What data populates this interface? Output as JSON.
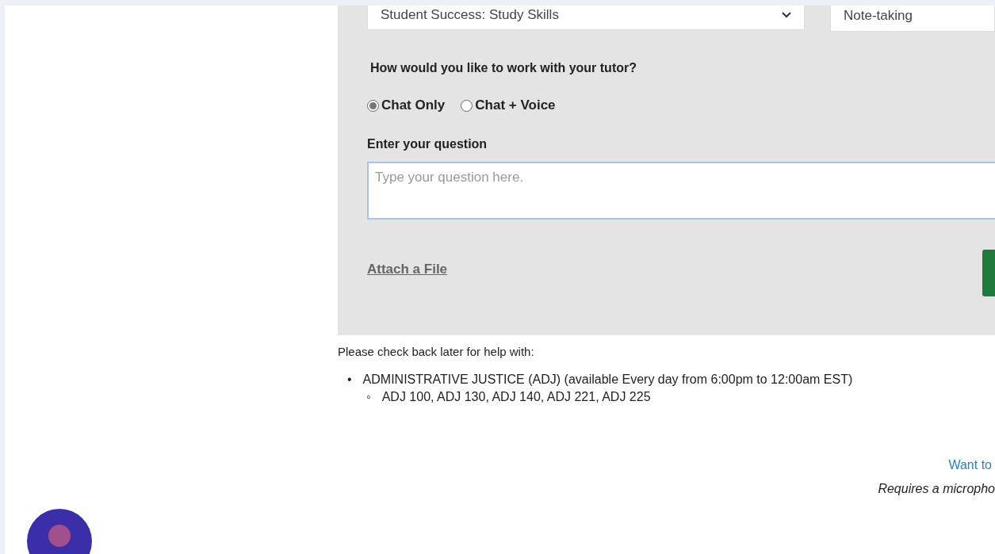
{
  "form": {
    "subject_select": {
      "value": "Student Success: Study Skills"
    },
    "topic_field": {
      "value": "Note-taking"
    },
    "mode_question": "How would you like to work with your tutor?",
    "modes": [
      {
        "label": "Chat Only",
        "selected": true
      },
      {
        "label": "Chat + Voice",
        "selected": false
      }
    ],
    "question_label": "Enter your question",
    "question_field": {
      "placeholder": "Type your question here."
    },
    "attach_link": "Attach a File"
  },
  "notice": {
    "intro": "Please check back later for help with:",
    "subjects": [
      {
        "marker": "•",
        "name": "ADMINISTRATIVE JUSTICE (ADJ) (available Every day from 6:00pm to 12:00am EST)",
        "children": [
          {
            "marker": "◦",
            "name": "ADJ 100, ADJ 130, ADJ 140, ADJ 221, ADJ 225"
          }
        ]
      }
    ]
  },
  "voice_link": "Want to",
  "voice_note": "Requires a micropho"
}
